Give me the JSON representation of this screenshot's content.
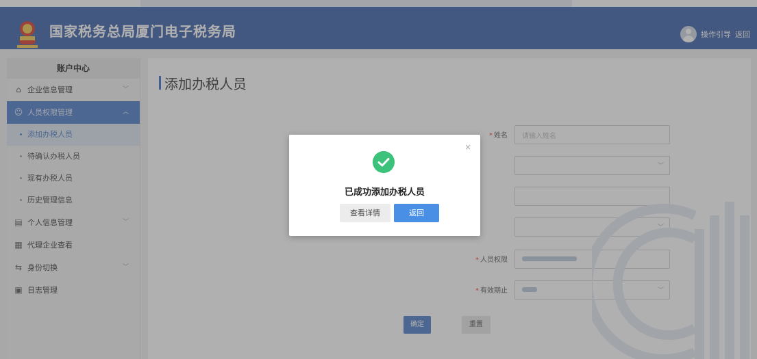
{
  "header": {
    "title": "国家税务总局厦门电子税务局",
    "guide": "操作引导",
    "back": "返回"
  },
  "sidebar": {
    "heading": "账户中心",
    "items": [
      {
        "label": "企业信息管理",
        "icon": "building-icon"
      },
      {
        "label": "人员权限管理",
        "icon": "users-icon"
      },
      {
        "label": "个人信息管理",
        "icon": "profile-card-icon"
      },
      {
        "label": "代理企业查看",
        "icon": "agency-icon"
      },
      {
        "label": "身份切换",
        "icon": "switch-icon"
      },
      {
        "label": "日志管理",
        "icon": "log-icon"
      }
    ],
    "sub_items": [
      "添加办税人员",
      "待确认办税人员",
      "现有办税人员",
      "历史管理信息"
    ]
  },
  "main": {
    "title": "添加办税人员",
    "form": {
      "name_label": "姓名",
      "name_placeholder": "请输入姓名",
      "permission_label": "人员权限",
      "validity_label": "有效期止"
    },
    "confirm_button": "确定",
    "reset_button": "重置"
  },
  "dialog": {
    "message": "已成功添加办税人员",
    "detail_button": "查看详情",
    "back_button": "返回",
    "close": "×"
  },
  "colors": {
    "header_bg": "#3a5fa8",
    "accent": "#4a7cc9",
    "success": "#3cc27a"
  }
}
